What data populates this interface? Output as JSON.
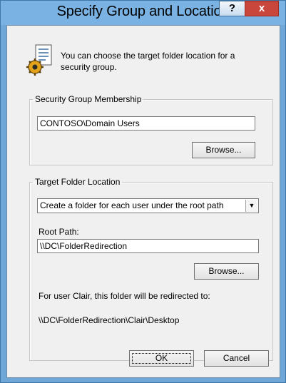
{
  "window": {
    "title": "Specify Group and Location",
    "help_glyph": "?",
    "close_glyph": "x"
  },
  "intro": {
    "icon": "group-policy-icon",
    "text": "You can choose the target folder location for a security group."
  },
  "membership": {
    "legend": "Security Group Membership",
    "group_value": "CONTOSO\\Domain Users",
    "browse_label": "Browse..."
  },
  "target": {
    "legend": "Target Folder Location",
    "location_option": "Create a folder for each user under the root path",
    "root_path_label": "Root Path:",
    "root_path_value": "\\\\DC\\FolderRedirection",
    "browse_label": "Browse...",
    "preview_label": "For user Clair, this folder will be redirected to:",
    "preview_path": "\\\\DC\\FolderRedirection\\Clair\\Desktop"
  },
  "footer": {
    "ok_label": "OK",
    "cancel_label": "Cancel"
  }
}
